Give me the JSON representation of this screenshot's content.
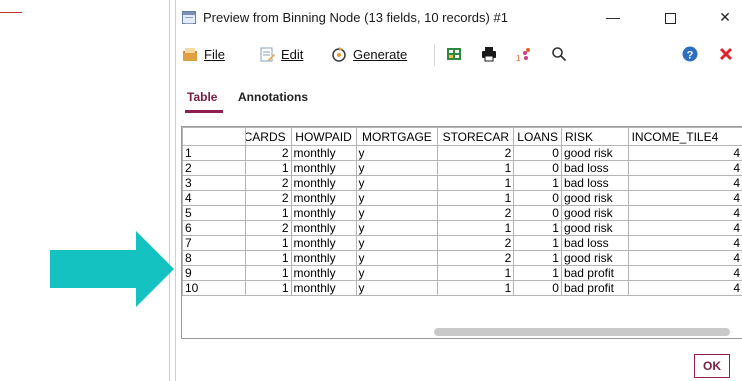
{
  "window": {
    "title": "Preview from Binning Node (13 fields, 10 records) #1"
  },
  "window_controls": {
    "minimize": "—",
    "close": "✕"
  },
  "toolbar": {
    "file_label": "File",
    "edit_label": "Edit",
    "generate_label": "Generate"
  },
  "tabs": [
    {
      "label": "Table"
    },
    {
      "label": "Annotations"
    }
  ],
  "table": {
    "columns": [
      "",
      "CARDS",
      "HOWPAID",
      "MORTGAGE",
      "STORECAR",
      "LOANS",
      "RISK",
      "INCOME_TILE4"
    ],
    "rows": [
      [
        "1",
        "2",
        "monthly",
        "y",
        "2",
        "0",
        "good risk",
        "4"
      ],
      [
        "2",
        "1",
        "monthly",
        "y",
        "1",
        "0",
        "bad loss",
        "4"
      ],
      [
        "3",
        "2",
        "monthly",
        "y",
        "1",
        "1",
        "bad loss",
        "4"
      ],
      [
        "4",
        "2",
        "monthly",
        "y",
        "1",
        "0",
        "good risk",
        "4"
      ],
      [
        "5",
        "1",
        "monthly",
        "y",
        "2",
        "0",
        "good risk",
        "4"
      ],
      [
        "6",
        "2",
        "monthly",
        "y",
        "1",
        "1",
        "good risk",
        "4"
      ],
      [
        "7",
        "1",
        "monthly",
        "y",
        "2",
        "1",
        "bad loss",
        "4"
      ],
      [
        "8",
        "1",
        "monthly",
        "y",
        "2",
        "1",
        "good risk",
        "4"
      ],
      [
        "9",
        "1",
        "monthly",
        "y",
        "1",
        "1",
        "bad profit",
        "4"
      ],
      [
        "10",
        "1",
        "monthly",
        "y",
        "1",
        "0",
        "bad profit",
        "4"
      ]
    ]
  },
  "footer": {
    "ok_label": "OK"
  },
  "colors": {
    "accent": "#8c1f4e",
    "arrow": "#14c2c2"
  }
}
